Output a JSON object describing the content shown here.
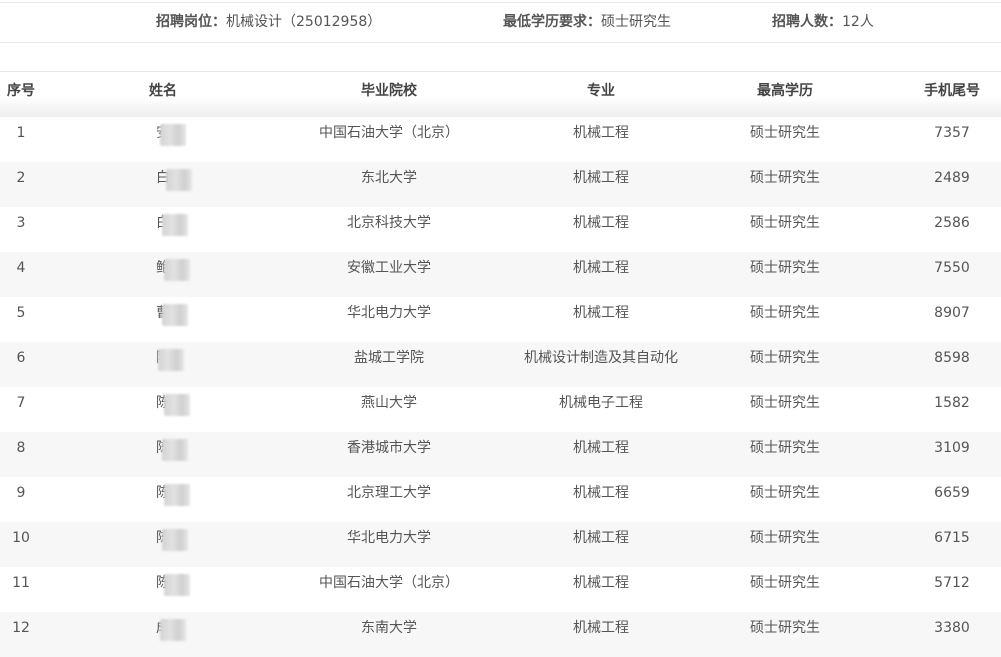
{
  "info": {
    "position_label": "招聘岗位：",
    "position_value": "机械设计（25012958）",
    "edu_label": "最低学历要求：",
    "edu_value": "硕士研究生",
    "count_label": "招聘人数：",
    "count_value": "12人"
  },
  "table": {
    "headers": [
      "序号",
      "姓名",
      "毕业院校",
      "专业",
      "最高学历",
      "手机尾号"
    ],
    "rows": [
      {
        "idx": "1",
        "name": "安",
        "school": "中国石油大学（北京）",
        "major": "机械工程",
        "degree": "硕士研究生",
        "phone": "7357"
      },
      {
        "idx": "2",
        "name": "白",
        "school": "东北大学",
        "major": "机械工程",
        "degree": "硕士研究生",
        "phone": "2489"
      },
      {
        "idx": "3",
        "name": "白",
        "school": "北京科技大学",
        "major": "机械工程",
        "degree": "硕士研究生",
        "phone": "2586"
      },
      {
        "idx": "4",
        "name": "鲍",
        "school": "安徽工业大学",
        "major": "机械工程",
        "degree": "硕士研究生",
        "phone": "7550"
      },
      {
        "idx": "5",
        "name": "曹",
        "school": "华北电力大学",
        "major": "机械工程",
        "degree": "硕士研究生",
        "phone": "8907"
      },
      {
        "idx": "6",
        "name": "陈",
        "school": "盐城工学院",
        "major": "机械设计制造及其自动化",
        "degree": "硕士研究生",
        "phone": "8598"
      },
      {
        "idx": "7",
        "name": "陈",
        "school": "燕山大学",
        "major": "机械电子工程",
        "degree": "硕士研究生",
        "phone": "1582"
      },
      {
        "idx": "8",
        "name": "陈",
        "school": "香港城市大学",
        "major": "机械工程",
        "degree": "硕士研究生",
        "phone": "3109"
      },
      {
        "idx": "9",
        "name": "陈",
        "school": "北京理工大学",
        "major": "机械工程",
        "degree": "硕士研究生",
        "phone": "6659"
      },
      {
        "idx": "10",
        "name": "陈",
        "school": "华北电力大学",
        "major": "机械工程",
        "degree": "硕士研究生",
        "phone": "6715"
      },
      {
        "idx": "11",
        "name": "陈",
        "school": "中国石油大学（北京）",
        "major": "机械工程",
        "degree": "硕士研究生",
        "phone": "5712"
      },
      {
        "idx": "12",
        "name": "成",
        "school": "东南大学",
        "major": "机械工程",
        "degree": "硕士研究生",
        "phone": "3380"
      }
    ]
  },
  "colors": {
    "text": "#555555",
    "header_text": "#444444",
    "row_alt_bg": "#f7f7f7",
    "border": "#e6e6e6"
  }
}
